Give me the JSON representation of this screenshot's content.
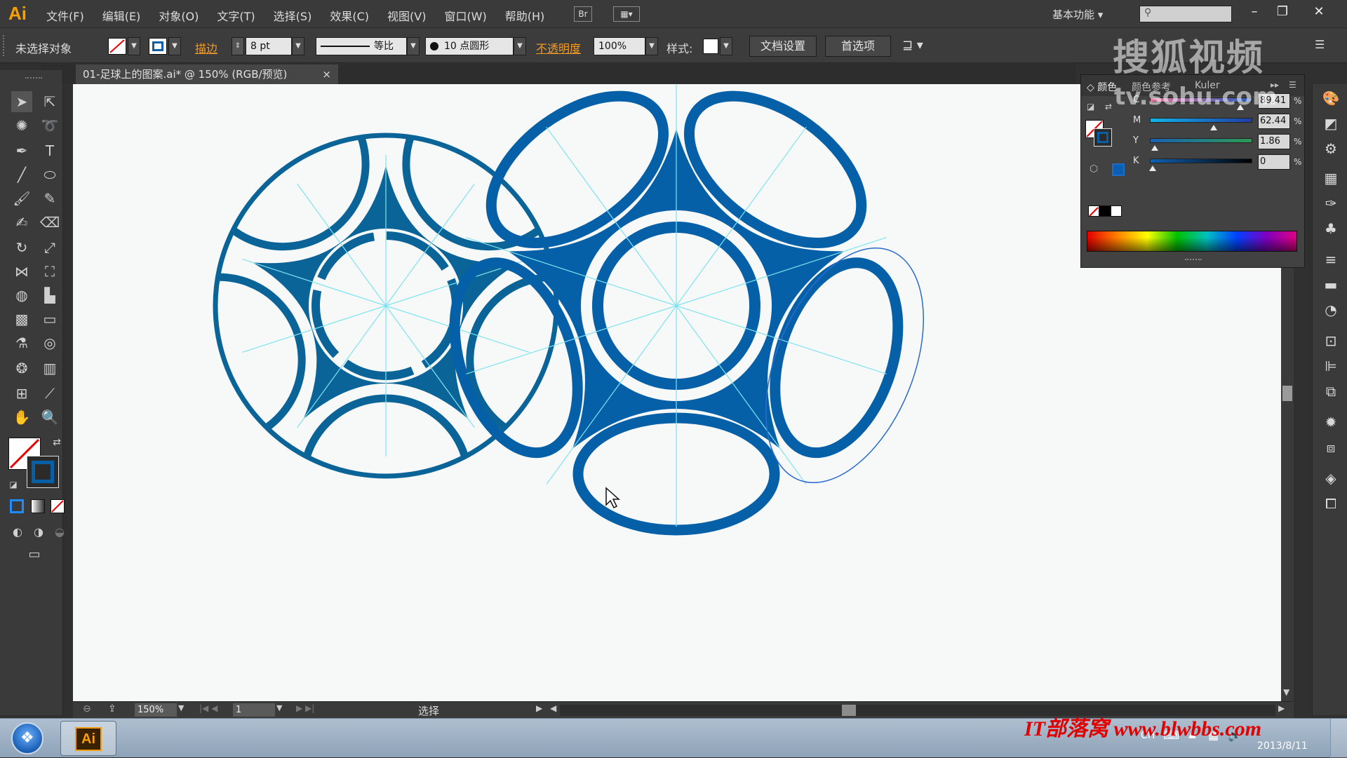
{
  "app": {
    "logo": "Ai",
    "menu": [
      "文件(F)",
      "编辑(E)",
      "对象(O)",
      "文字(T)",
      "选择(S)",
      "效果(C)",
      "视图(V)",
      "窗口(W)",
      "帮助(H)"
    ],
    "bridge_btn": "Br",
    "workspace": "基本功能"
  },
  "control_bar": {
    "selection": "未选择对象",
    "stroke_label": "描边",
    "stroke_weight": "8 pt",
    "profile_label": "等比",
    "brush_label": "10 点圆形",
    "opacity_label": "不透明度",
    "opacity_value": "100%",
    "style_label": "样式:",
    "doc_setup_btn": "文档设置",
    "prefs_btn": "首选项"
  },
  "document": {
    "tab_title": "01-足球上的图案.ai* @ 150% (RGB/预览)",
    "close_glyph": "×"
  },
  "color_panel": {
    "tabs": [
      "颜色",
      "颜色参考",
      "Kuler"
    ],
    "channels": [
      {
        "label": "C",
        "value": "89.41",
        "fraction": 0.894
      },
      {
        "label": "M",
        "value": "62.44",
        "fraction": 0.624
      },
      {
        "label": "Y",
        "value": "1.86",
        "fraction": 0.019
      },
      {
        "label": "K",
        "value": "0",
        "fraction": 0.0
      }
    ],
    "pct": "%"
  },
  "status_bar": {
    "zoom": "150%",
    "artboard": "1",
    "tool_name": "选择"
  },
  "taskbar": {
    "ai_label": "Ai",
    "watermark": "IT部落窝 www.blwbbs.com",
    "ime": "CH",
    "date": "2013/8/11"
  },
  "watermarks": {
    "brand": "搜狐视频",
    "url": "tv.sohu.com"
  },
  "colors": {
    "ball_blue": "#0660a8",
    "left_blue": "#0b6498",
    "guide_cyan": "#7fe3f0",
    "accent_orange": "#f19a28"
  }
}
